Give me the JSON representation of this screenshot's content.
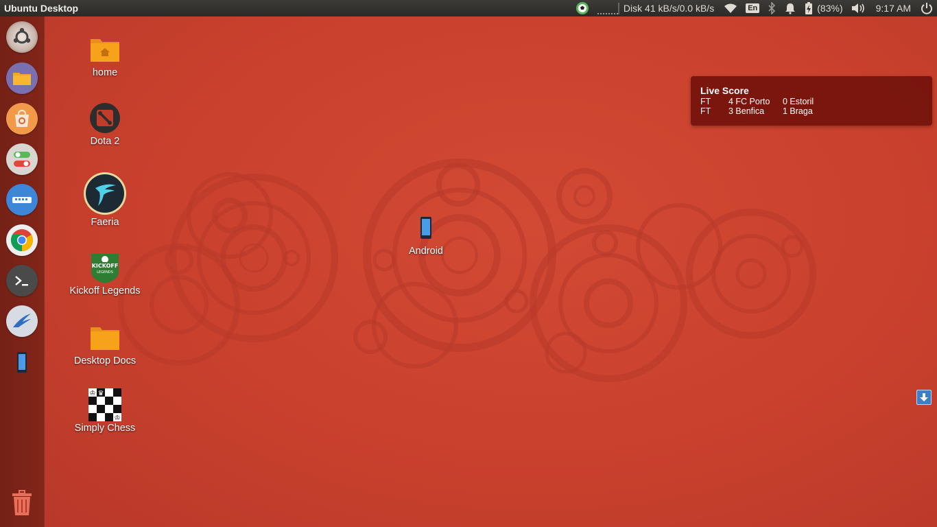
{
  "panel": {
    "title": "Ubuntu Desktop",
    "disk": "Disk 41 kB/s/0.0 kB/s",
    "keyboard": "En",
    "battery": "(83%)",
    "time": "9:17 AM"
  },
  "launcher": {
    "items": [
      {
        "name": "ubuntu-dash-icon"
      },
      {
        "name": "files-icon"
      },
      {
        "name": "software-center-icon"
      },
      {
        "name": "settings-toggle-icon"
      },
      {
        "name": "network-manager-icon"
      },
      {
        "name": "chrome-icon"
      },
      {
        "name": "terminal-icon"
      },
      {
        "name": "app-bird-icon"
      },
      {
        "name": "android-phone-icon"
      },
      {
        "name": "trash-icon"
      }
    ]
  },
  "desktop": {
    "icons": [
      {
        "label": "home"
      },
      {
        "label": "Dota 2"
      },
      {
        "label": "Faeria"
      },
      {
        "label": "Kickoff Legends"
      },
      {
        "label": "Desktop Docs"
      },
      {
        "label": "Simply Chess"
      },
      {
        "label": "Android"
      }
    ],
    "kickoff_badge_top": "KICKOFF",
    "kickoff_badge_bottom": "LEGENDS"
  },
  "live_score": {
    "title": "Live Score",
    "rows": [
      {
        "status": "FT",
        "home": "4 FC Porto",
        "away": "0 Estoril"
      },
      {
        "status": "FT",
        "home": "3 Benfica",
        "away": "1 Braga"
      }
    ]
  },
  "colors": {
    "wallpaper": "#c8412e",
    "panel": "#3c3b37",
    "launcher": "#6e1e14",
    "folder": "#f7a21b"
  }
}
